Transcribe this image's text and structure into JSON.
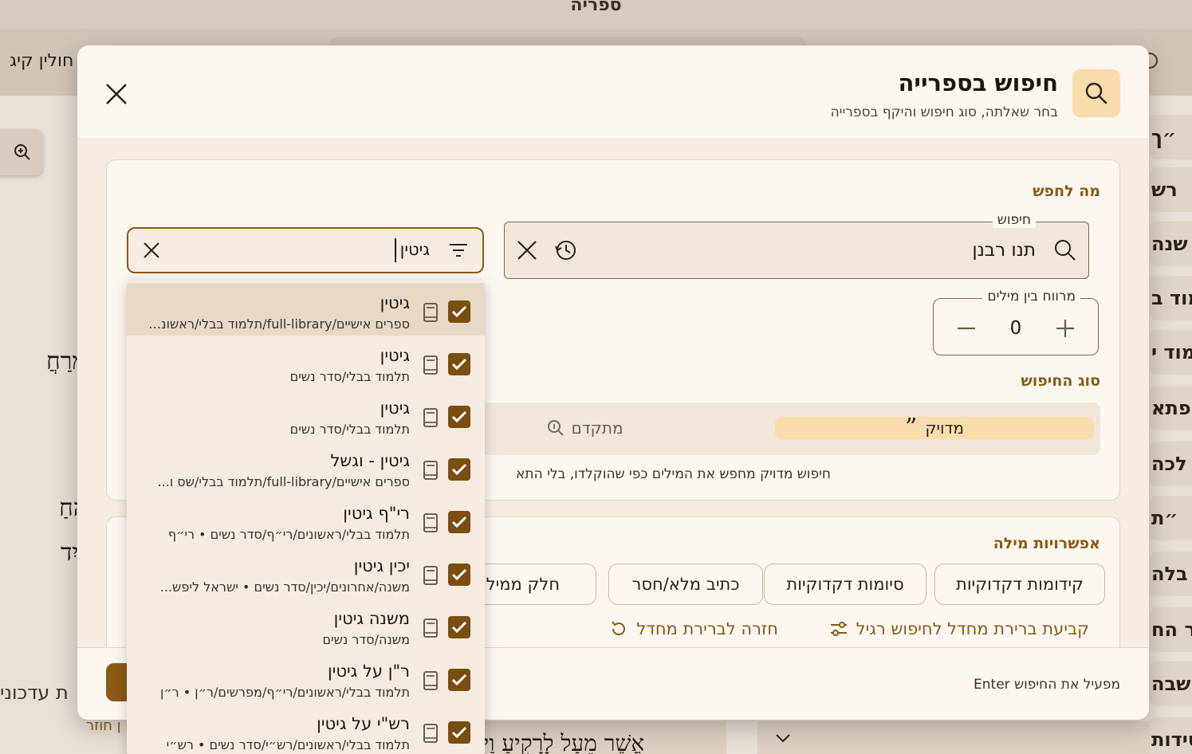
{
  "app": {
    "title": "ספריה",
    "tab_label": "חולין קיג",
    "text_fragments": [
      "ים מְרַחֲ",
      "ין הַחַ",
      "רֶב וְיִד",
      "ת עדכוני",
      "ן חוזר",
      "אֲשֶׁר מֵעַל לָרָקִיעַ וַי"
    ],
    "sidebar_items": [
      "״ך",
      "רש",
      "שנה",
      "למוד ב",
      "למוד י",
      "ספתא",
      "לכה",
      "״ת",
      "בלה",
      "ר הח",
      "חשבה",
      "סידות"
    ]
  },
  "dialog": {
    "title": "חיפוש בספרייה",
    "subtitle": "בחר שאלתה, סוג חיפוש והיקף בספרייה",
    "what_section": {
      "label": "מה לחפש",
      "search_legend": "חיפוש",
      "search_value": "תנו רבנן",
      "book_filter_value": "גיטין",
      "gap_legend": "מרווח בין מילים",
      "gap_value": "0",
      "type_label": "סוג החיפוש",
      "type_exact": "מדויק",
      "type_advanced": "מתקדם",
      "type_description": "חיפוש מדויק מחפש את המילים כפי שהוקלדו, בלי התא"
    },
    "options_section": {
      "label": "אפשרויות מילה",
      "chips": [
        "קידומות דקדוקיות",
        "סיומות דקדוקיות",
        "כתיב מלא/חסר",
        "חלק ממילה"
      ],
      "set_default_link": "קביעת ברירת מחדל לחיפוש רגיל",
      "reset_default_link": "חזרה לברירת מחדל"
    },
    "footer_hint": "Enter מפעיל את החיפוש"
  },
  "dropdown": {
    "items": [
      {
        "title": "גיטין",
        "path": "ספרים אישיים/full-library/תלמוד בבלי/ראשונים/...",
        "checked": true
      },
      {
        "title": "גיטין",
        "path": "תלמוד בבלי/סדר נשים",
        "checked": true
      },
      {
        "title": "גיטין",
        "path": "תלמוד בבלי/סדר נשים",
        "checked": true
      },
      {
        "title": "גיטין - וגשל",
        "path": "ספרים אישיים/full-library/תלמוד בבלי/שס ו...",
        "checked": true
      },
      {
        "title": "רי\"ף גיטין",
        "path": "תלמוד בבלי/ראשונים/רי״ף/סדר נשים • רי״ף",
        "checked": true
      },
      {
        "title": "יכין גיטין",
        "path": "משנה/אחרונים/יכין/סדר נשים • ישראל ליפש...",
        "checked": true
      },
      {
        "title": "משנה גיטין",
        "path": "משנה/סדר נשים",
        "checked": true
      },
      {
        "title": "ר\"ן על גיטין",
        "path": "תלמוד בבלי/ראשונים/רי״ף/מפרשים/ר״ן • ר״ן",
        "checked": true
      },
      {
        "title": "רש\"י על גיטין",
        "path": "תלמוד בבלי/ראשונים/רש״י/סדר נשים • רש״י",
        "checked": true
      }
    ]
  },
  "colors": {
    "accent": "#8a5a14",
    "checkbox": "#7a4e10",
    "highlight": "#f9dcab",
    "dialog_bg": "#fdf7f1",
    "body_bg": "#f6ece2"
  },
  "icons": {
    "header": "search-icon",
    "close": "close-icon",
    "history": "history-icon",
    "filter": "filter-icon",
    "book": "book-icon",
    "check": "check-icon"
  }
}
